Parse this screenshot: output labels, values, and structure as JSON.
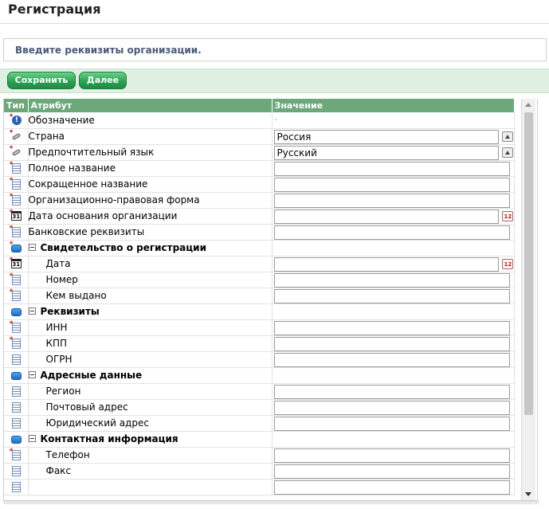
{
  "page": {
    "title": "Регистрация"
  },
  "info": {
    "message": "Введите реквизиты организации."
  },
  "toolbar": {
    "save_label": "Сохранить",
    "next_label": "Далее"
  },
  "grid": {
    "columns": {
      "type": "Тип",
      "attribute": "Атрибут",
      "value": "Значение"
    },
    "rows": [
      {
        "icon": "info-icon",
        "required": true,
        "label": "Обозначение",
        "indent": false,
        "group": false,
        "control": "dot",
        "value": "."
      },
      {
        "icon": "link-icon",
        "required": true,
        "label": "Страна",
        "indent": false,
        "group": false,
        "control": "combo",
        "value": "Россия"
      },
      {
        "icon": "link-icon",
        "required": true,
        "label": "Предпочтительный язык",
        "indent": false,
        "group": false,
        "control": "combo",
        "value": "Русский"
      },
      {
        "icon": "document-icon",
        "required": true,
        "label": "Полное название",
        "indent": false,
        "group": false,
        "control": "text",
        "value": ""
      },
      {
        "icon": "document-icon",
        "required": true,
        "label": "Сокращенное название",
        "indent": false,
        "group": false,
        "control": "text",
        "value": ""
      },
      {
        "icon": "document-icon",
        "required": true,
        "label": "Организационно-правовая форма",
        "indent": false,
        "group": false,
        "control": "text",
        "value": ""
      },
      {
        "icon": "calendar-icon",
        "required": true,
        "label": "Дата основания организации",
        "indent": false,
        "group": false,
        "control": "date",
        "value": ""
      },
      {
        "icon": "document-icon",
        "required": true,
        "label": "Банковские реквизиты",
        "indent": false,
        "group": false,
        "control": "text",
        "value": ""
      },
      {
        "icon": "folder-icon",
        "required": true,
        "label": "Свидетельство о регистрации",
        "indent": false,
        "group": true,
        "control": "none",
        "value": ""
      },
      {
        "icon": "calendar-icon",
        "required": true,
        "label": "Дата",
        "indent": true,
        "group": false,
        "control": "date",
        "value": ""
      },
      {
        "icon": "document-icon",
        "required": true,
        "label": "Номер",
        "indent": true,
        "group": false,
        "control": "text",
        "value": ""
      },
      {
        "icon": "document-icon",
        "required": true,
        "label": "Кем выдано",
        "indent": true,
        "group": false,
        "control": "text",
        "value": ""
      },
      {
        "icon": "folder-icon",
        "required": false,
        "label": "Реквизиты",
        "indent": false,
        "group": true,
        "control": "none",
        "value": ""
      },
      {
        "icon": "document-icon",
        "required": true,
        "label": "ИНН",
        "indent": true,
        "group": false,
        "control": "text",
        "value": ""
      },
      {
        "icon": "document-icon",
        "required": true,
        "label": "КПП",
        "indent": true,
        "group": false,
        "control": "text",
        "value": ""
      },
      {
        "icon": "document-icon",
        "required": false,
        "label": "ОГРН",
        "indent": true,
        "group": false,
        "control": "text",
        "value": ""
      },
      {
        "icon": "folder-icon",
        "required": false,
        "label": "Адресные данные",
        "indent": false,
        "group": true,
        "control": "none",
        "value": ""
      },
      {
        "icon": "document-icon",
        "required": false,
        "label": "Регион",
        "indent": true,
        "group": false,
        "control": "text",
        "value": ""
      },
      {
        "icon": "document-icon",
        "required": false,
        "label": "Почтовый адрес",
        "indent": true,
        "group": false,
        "control": "text",
        "value": ""
      },
      {
        "icon": "document-icon",
        "required": false,
        "label": "Юридический адрес",
        "indent": true,
        "group": false,
        "control": "text",
        "value": ""
      },
      {
        "icon": "folder-icon",
        "required": false,
        "label": "Контактная информация",
        "indent": false,
        "group": true,
        "control": "none",
        "value": ""
      },
      {
        "icon": "document-icon",
        "required": true,
        "label": "Телефон",
        "indent": true,
        "group": false,
        "control": "text",
        "value": ""
      },
      {
        "icon": "document-icon",
        "required": false,
        "label": "Факс",
        "indent": true,
        "group": false,
        "control": "text",
        "value": ""
      },
      {
        "icon": "document-icon",
        "required": false,
        "label": "",
        "indent": true,
        "group": false,
        "control": "text",
        "value": ""
      }
    ]
  }
}
